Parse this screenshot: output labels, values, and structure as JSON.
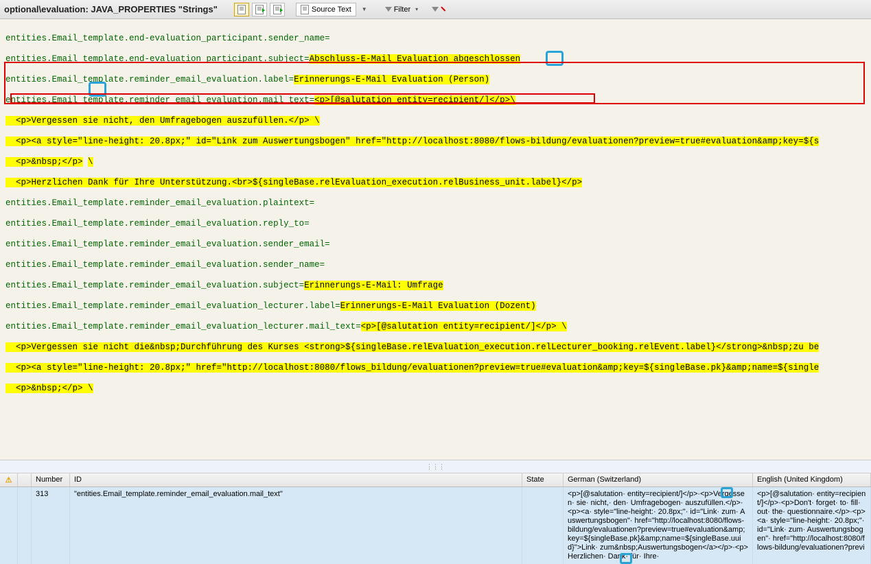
{
  "header": {
    "title": "optional\\evaluation: JAVA_PROPERTIES \"Strings\"",
    "source_text_label": "Source Text",
    "filter_label": "Filter"
  },
  "code": {
    "l1": "entities.Email_template.end-evaluation_participant.sender_name=",
    "l2_key": "entities.Email_template.end-evaluation_participant.subject=",
    "l2_val": "Abschluss-E-Mail Evaluation abgeschlossen",
    "l3_key": "entities.Email_template.reminder_email_evaluation.label=",
    "l3_val": "Erinnerungs-E-Mail Evaluation (Person)",
    "l4_key": "entities.Email_template.reminder_email_evaluation.mail_text=",
    "l4_val": "<p>[@salutation entity=recipient/]</p>",
    "l4_bs": "\\",
    "l5": "  <p>Vergessen sie nicht, den Umfragebogen auszufüllen.</p> \\",
    "l6a": "  <p><a style=\"line-height: 20.8px;\" id=\"Link zum Auswertungsbogen\" href=\"http://localhost:8080/flows-bildung/evaluationen?preview=true#evaluation&amp;key=${s",
    "l7": "  <p>&nbsp;</p>",
    "l7_bs": "\\",
    "l8": "  <p>Herzlichen Dank für Ihre Unterstützung.<br>${singleBase.relEvaluation_execution.relBusiness_unit.label}</p>",
    "l9": "entities.Email_template.reminder_email_evaluation.plaintext=",
    "l10": "entities.Email_template.reminder_email_evaluation.reply_to=",
    "l11": "entities.Email_template.reminder_email_evaluation.sender_email=",
    "l12": "entities.Email_template.reminder_email_evaluation.sender_name=",
    "l13_key": "entities.Email_template.reminder_email_evaluation.subject=",
    "l13_val": "Erinnerungs-E-Mail: Umfrage",
    "l14_key": "entities.Email_template.reminder_email_evaluation_lecturer.label=",
    "l14_val": "Erinnerungs-E-Mail Evaluation (Dozent)",
    "l15_key": "entities.Email_template.reminder_email_evaluation_lecturer.mail_text=",
    "l15_val": "<p>[@salutation entity=recipient/]</p> \\",
    "l16": "  <p>Vergessen sie nicht die&nbsp;Durchführung des Kurses <strong>${singleBase.relEvaluation_execution.relLecturer_booking.relEvent.label}</strong>&nbsp;zu be",
    "l17": "  <p><a style=\"line-height: 20.8px;\" href=\"http://localhost:8080/flows_bildung/evaluationen?preview=true#evaluation&amp;key=${singleBase.pk}&amp;name=${single",
    "l18": "  <p>&nbsp;</p> \\"
  },
  "grid": {
    "headers": {
      "number": "Number",
      "id": "ID",
      "state": "State",
      "german": "German (Switzerland)",
      "english": "English (United Kingdom)"
    },
    "row": {
      "number": "313",
      "id": "\"entities.Email_template.reminder_email_evaluation.mail_text\"",
      "state": "",
      "german": "<p>[@salutation· entity=recipient/]</p>·<p>Vergessen· sie· nicht,· den· Umfragebogen· auszufüllen.</p>· <p><a· style=\"line-height:· 20.8px;\"· id=\"Link· zum· Auswertungsbogen\"· href=\"http://localhost:8080/flows-bildung/evaluationen?preview=true#evaluation&amp;key=${singleBase.pk}&amp;name=${singleBase.uuid}\">Link· zum&nbsp;Auswertungsbogen</a></p>·<p>Herzlichen· Dank· für· Ihre·",
      "english": "<p>[@salutation· entity=recipient/]</p>·<p>Don't· forget· to· fill· out· the· questionnaire.</p>·<p><a· style=\"line-height:· 20.8px;\"· id=\"Link· zum· Auswertungsbogen\"· href=\"http://localhost:8080/flows-bildung/evaluationen?previ"
    }
  }
}
